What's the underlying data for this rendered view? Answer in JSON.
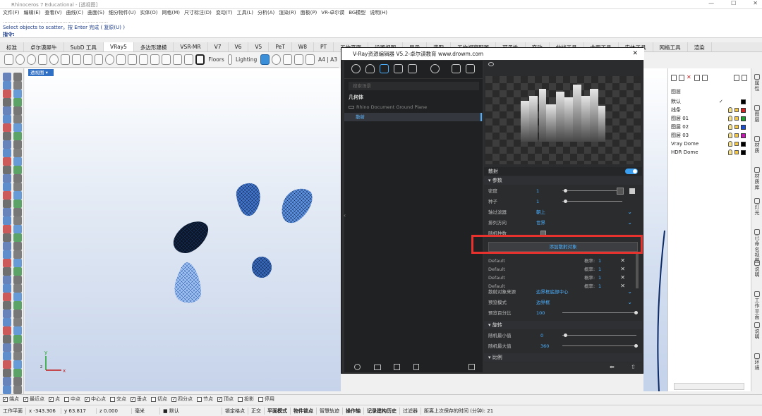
{
  "app": {
    "title": "Rhinoceros 7 Educational - [透视图]"
  },
  "menu": [
    "文件(F)",
    "编辑(E)",
    "查看(V)",
    "曲线(C)",
    "曲面(S)",
    "细分物件(U)",
    "实体(O)",
    "网格(M)",
    "尺寸标注(D)",
    "变动(T)",
    "工具(L)",
    "分析(A)",
    "渲染(R)",
    "面板(P)",
    "VR-卓尔谟",
    "BG模型",
    "说明(H)"
  ],
  "command": {
    "history": "...................................................................",
    "prompt_line": "Select objects to scatter。按 Enter 完成 ( 复原(U) )",
    "input_label": "指令:"
  },
  "tabs": [
    "标准",
    "卓尔谟犀牛",
    "SubD 工具",
    "VRay5",
    "多边形建模",
    "VSR-MR",
    "V7",
    "V6",
    "V5",
    "PeT",
    "W8",
    "PT",
    "工作平面",
    "设置视图",
    "显示",
    "选取",
    "工作视窗配置",
    "可见性",
    "变动",
    "曲线工具",
    "曲面工具",
    "实体工具",
    "网格工具",
    "渲染"
  ],
  "toolbar_labels": {
    "floors": "Floors",
    "lighting": "Lighting",
    "paper": "A4 | A3"
  },
  "viewport": {
    "label": "透视图 ▾",
    "axis_y": "y",
    "axis_x": "x",
    "axis_z": "z"
  },
  "dialog": {
    "title": "V-Ray资源编辑器 V5.2-卓尔谟教育 www.drowm.com",
    "search_placeholder": "搜索场景",
    "category": "几何体",
    "items": [
      "Rhino Document Ground Plane",
      "散射"
    ],
    "section_title": "散射",
    "params_header": "参数",
    "density_label": "密度",
    "density_value": "1",
    "seed_label": "种子",
    "seed_value": "1",
    "axis_filter_label": "轴过滤器",
    "axis_filter_value": "朝上",
    "orient_label": "排列方向",
    "orient_value": "世界",
    "random_label": "随机种数",
    "add_button": "添加散射对象",
    "objects": [
      {
        "name": "Default",
        "prob_label": "概率:",
        "prob": "1"
      },
      {
        "name": "Default",
        "prob_label": "概率:",
        "prob": "1"
      },
      {
        "name": "Default",
        "prob_label": "概率:",
        "prob": "1"
      },
      {
        "name": "Default",
        "prob_label": "概率:",
        "prob": "1"
      }
    ],
    "source_label": "散射对象来源",
    "source_value": "边界框底部中心",
    "preview_mode_label": "预览模式",
    "preview_mode_value": "边界框",
    "preview_pct_label": "预览百分比",
    "preview_pct_value": "100",
    "rotation_header": "旋转",
    "rand_min_label": "随机最小值",
    "rand_min_value": "0",
    "rand_max_label": "随机最大值",
    "rand_max_value": "360",
    "scale_header": "比例"
  },
  "layers": {
    "header": "图层",
    "rows": [
      {
        "name": "默认",
        "check": "✓",
        "color": "#000000"
      },
      {
        "name": "线条",
        "color": "#d32222"
      },
      {
        "name": "图层 01",
        "color": "#1f9d2e"
      },
      {
        "name": "图层 02",
        "color": "#1a4fd0"
      },
      {
        "name": "图层 03",
        "color": "#c21ab0"
      },
      {
        "name": "Vray Dome",
        "color": "#000000"
      },
      {
        "name": "HDR Dome",
        "color": "#000000"
      }
    ]
  },
  "right_tabs": [
    "属性",
    "图层",
    "材质",
    "材质库",
    "灯光",
    "已命名视图",
    "说明",
    "工作平面",
    "说明",
    "环境"
  ],
  "osnap": [
    {
      "label": "端点",
      "checked": true
    },
    {
      "label": "最近点",
      "checked": true
    },
    {
      "label": "点",
      "checked": true
    },
    {
      "label": "中点",
      "checked": false
    },
    {
      "label": "中心点",
      "checked": true
    },
    {
      "label": "交点",
      "checked": false
    },
    {
      "label": "垂点",
      "checked": true
    },
    {
      "label": "切点",
      "checked": false
    },
    {
      "label": "四分点",
      "checked": true
    },
    {
      "label": "节点",
      "checked": false
    },
    {
      "label": "顶点",
      "checked": true
    },
    {
      "label": "投影",
      "checked": false
    },
    {
      "label": "停用",
      "checked": false
    }
  ],
  "status": {
    "cplane": "工作平面",
    "x": "x -343.306",
    "y": "y 63.817",
    "z": "z 0.000",
    "unit": "毫米",
    "layer": "■ 默认",
    "items": [
      "锁定格点",
      "正交",
      "平面模式",
      "物件锁点",
      "智慧轨迹",
      "操作轴",
      "记录建构历史",
      "过滤器"
    ],
    "save_info": "距离上次保存的时间 (分钟): 21"
  }
}
